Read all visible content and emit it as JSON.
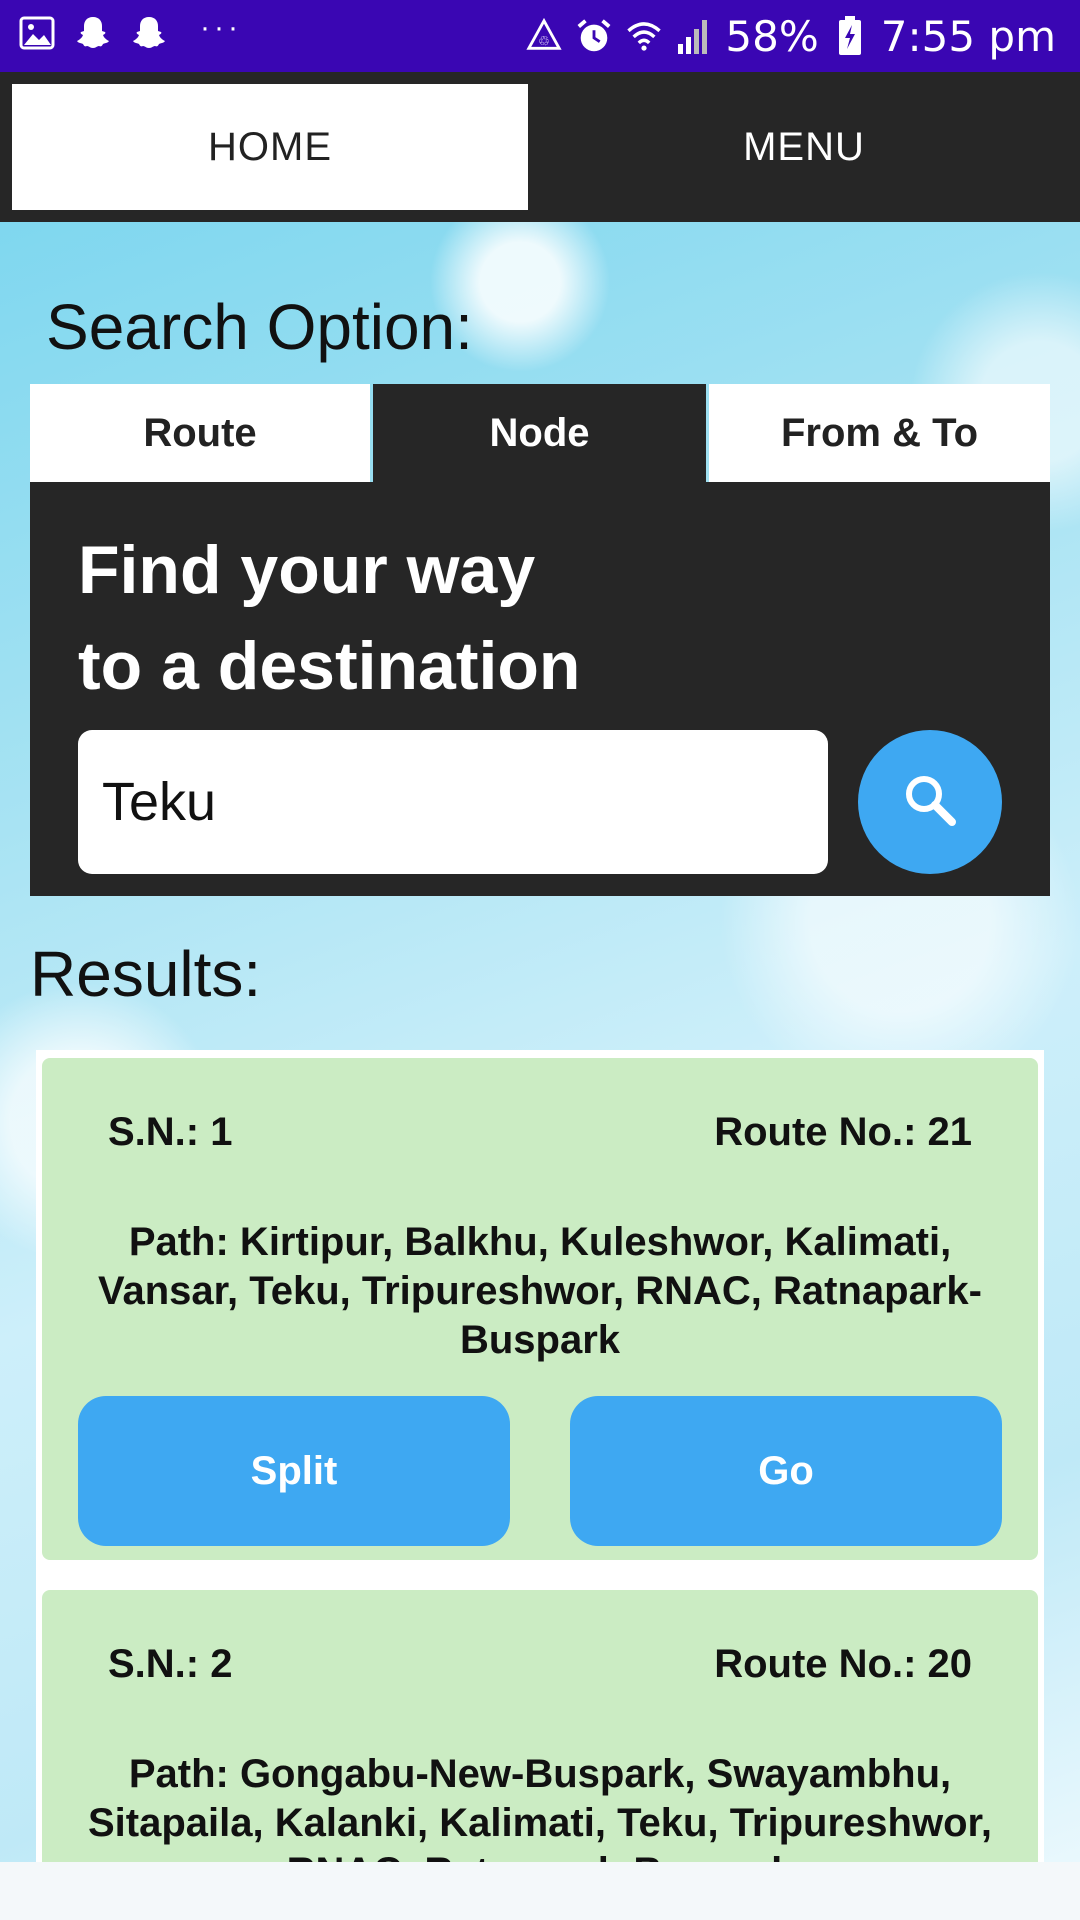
{
  "status_bar": {
    "battery": "58%",
    "time": "7:55 pm",
    "overflow": "···"
  },
  "nav": {
    "home": "HOME",
    "menu": "MENU"
  },
  "search": {
    "heading": "Search Option:",
    "tabs": [
      "Route",
      "Node",
      "From & To"
    ],
    "selected_tab": "Node",
    "title_line1": "Find your way",
    "title_line2": "to a destination",
    "query": "Teku"
  },
  "results": {
    "heading": "Results:",
    "items": [
      {
        "sn": "S.N.: 1",
        "route_no": "Route No.: 21",
        "path": "Path: Kirtipur, Balkhu, Kuleshwor, Kalimati, Vansar, Teku, Tripureshwor, RNAC, Ratnapark-Buspark",
        "split_label": "Split",
        "go_label": "Go"
      },
      {
        "sn": "S.N.: 2",
        "route_no": "Route No.: 20",
        "path": "Path: Gongabu-New-Buspark, Swayambhu, Sitapaila, Kalanki, Kalimati, Teku, Tripureshwor, RNAC, Ratnapark-Buspark"
      }
    ]
  },
  "colors": {
    "status_bar": "#3a06b3",
    "dark_panel": "#262626",
    "accent_blue": "#3ea8f2",
    "card_green": "#cbecc3"
  }
}
